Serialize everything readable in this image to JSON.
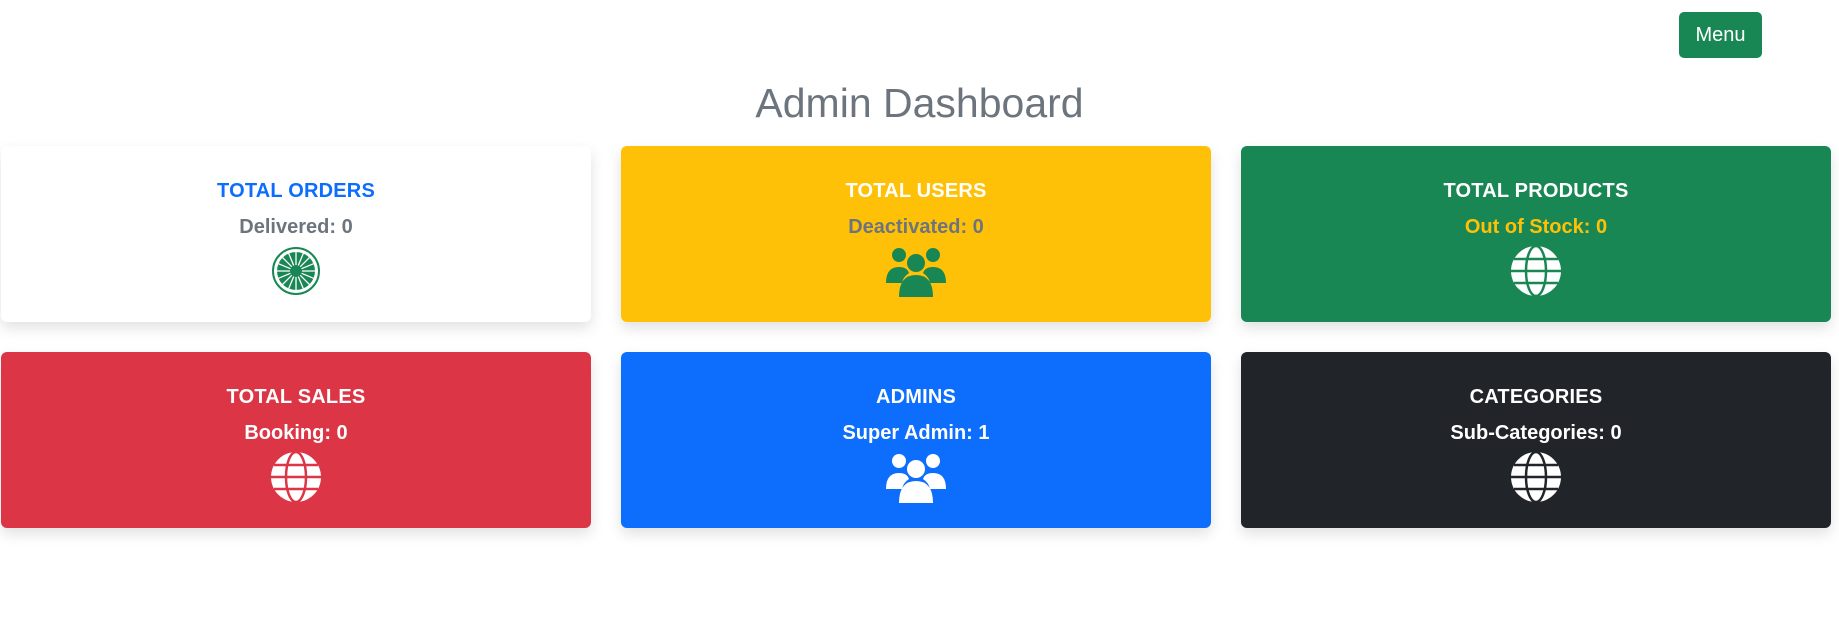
{
  "header": {
    "menu_label": "Menu",
    "title": "Admin Dashboard"
  },
  "cards": [
    {
      "title": "TOTAL ORDERS",
      "subtitle": "Delivered: 0",
      "icon": "spinner-icon",
      "bg": "#ffffff",
      "title_color": "#0d6efd",
      "subtitle_color": "#6c757d",
      "icon_color": "#198754"
    },
    {
      "title": "TOTAL USERS",
      "subtitle": "Deactivated: 0",
      "icon": "users-icon",
      "bg": "#ffc107",
      "title_color": "#ffffff",
      "subtitle_color": "#6c757d",
      "icon_color": "#198754"
    },
    {
      "title": "TOTAL PRODUCTS",
      "subtitle": "Out of Stock: 0",
      "icon": "globe-icon",
      "bg": "#198754",
      "title_color": "#ffffff",
      "subtitle_color": "#ffc107",
      "icon_color": "#ffffff"
    },
    {
      "title": "TOTAL SALES",
      "subtitle": "Booking: 0",
      "icon": "globe-icon",
      "bg": "#dc3545",
      "title_color": "#ffffff",
      "subtitle_color": "#ffffff",
      "icon_color": "#ffffff"
    },
    {
      "title": "ADMINS",
      "subtitle": "Super Admin: 1",
      "icon": "users-icon",
      "bg": "#0d6efd",
      "title_color": "#ffffff",
      "subtitle_color": "#ffffff",
      "icon_color": "#ffffff"
    },
    {
      "title": "CATEGORIES",
      "subtitle": "Sub-Categories: 0",
      "icon": "globe-icon",
      "bg": "#212529",
      "title_color": "#ffffff",
      "subtitle_color": "#ffffff",
      "icon_color": "#ffffff"
    }
  ]
}
